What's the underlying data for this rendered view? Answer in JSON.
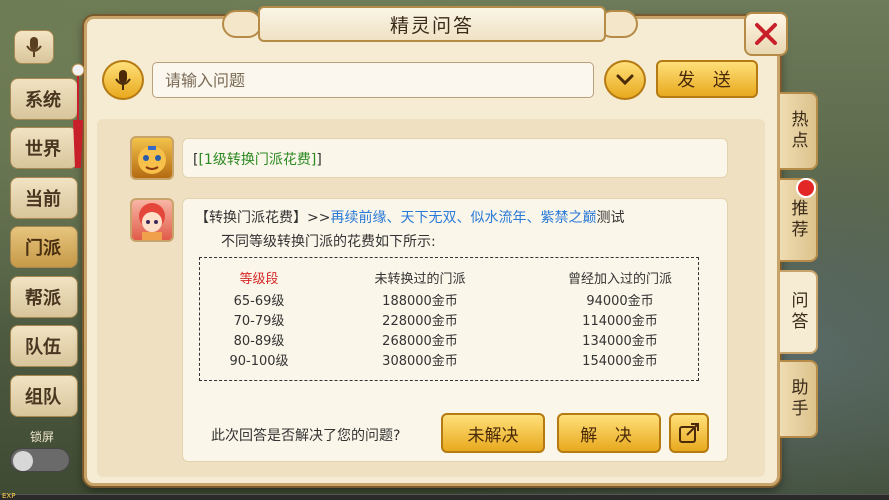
{
  "background": {
    "exp_label": "EXP"
  },
  "left_channels": [
    {
      "label": "系统",
      "active": false
    },
    {
      "label": "世界",
      "active": false
    },
    {
      "label": "当前",
      "active": false
    },
    {
      "label": "门派",
      "active": true
    },
    {
      "label": "帮派",
      "active": false
    },
    {
      "label": "队伍",
      "active": false
    },
    {
      "label": "组队",
      "active": false
    }
  ],
  "lock": {
    "label": "锁屏"
  },
  "dialog": {
    "title": "精灵问答",
    "input_placeholder": "请输入问题",
    "send_label": "发 送"
  },
  "chat": {
    "question_prefix": "[",
    "question_text": "[1级转换门派花费]",
    "question_suffix": "]",
    "answer_title": "【转换门派花费】>>",
    "answer_links": "再续前缘、天下无双、似水流年、紫禁之巅",
    "answer_title_suffix": "测试",
    "answer_line2": "不同等级转换门派的花费如下所示:",
    "table_header": {
      "level": "等级段",
      "not_converted": "未转换过的门派",
      "joined": "曾经加入过的门派"
    },
    "table_rows": [
      {
        "level": "65-69级",
        "not_converted": "188000金币",
        "joined": "94000金币"
      },
      {
        "level": "70-79级",
        "not_converted": "228000金币",
        "joined": "114000金币"
      },
      {
        "level": "80-89级",
        "not_converted": "268000金币",
        "joined": "134000金币"
      },
      {
        "level": "90-100级",
        "not_converted": "308000金币",
        "joined": "154000金币"
      }
    ],
    "feedback_question": "此次回答是否解决了您的问题?",
    "unresolved_label": "未解决",
    "resolved_label": "解 决"
  },
  "right_tabs": [
    {
      "label": "热点",
      "active": false
    },
    {
      "label": "推荐",
      "active": false,
      "badge": true
    },
    {
      "label": "问答",
      "active": true
    },
    {
      "label": "助手",
      "active": false
    }
  ],
  "colors": {
    "accent": "#e8a91e",
    "link": "#2a7ad8",
    "question_green": "#2d8a23",
    "header_red": "#d42a2a",
    "badge_red": "#e32626"
  }
}
